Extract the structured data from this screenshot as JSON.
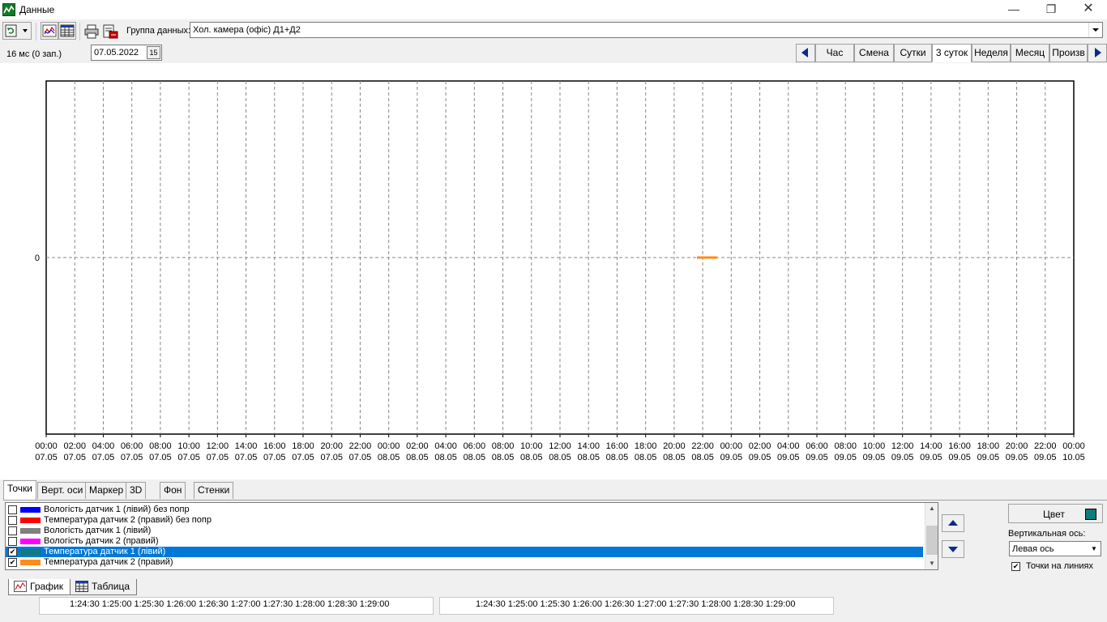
{
  "window": {
    "title": "Данные",
    "min_label": "—",
    "max_label": "❐",
    "close_label": "✕"
  },
  "toolbar": {
    "datagroup_label": "Группа данных:",
    "datagroup_value": "Хол. камера (офіс) Д1+Д2"
  },
  "periodbar": {
    "status": "16 мс (0 зап.)",
    "date": "07.05.2022",
    "calendar_label": "15",
    "buttons": [
      "Час",
      "Смена",
      "Сутки",
      "3 суток",
      "Неделя",
      "Месяц",
      "Произв"
    ],
    "active": "3 суток"
  },
  "chart_data": {
    "type": "line",
    "y_tick_labels": [
      "0"
    ],
    "x_tick_labels": [
      [
        "00:00",
        "07.05"
      ],
      [
        "02:00",
        "07.05"
      ],
      [
        "04:00",
        "07.05"
      ],
      [
        "06:00",
        "07.05"
      ],
      [
        "08:00",
        "07.05"
      ],
      [
        "10:00",
        "07.05"
      ],
      [
        "12:00",
        "07.05"
      ],
      [
        "14:00",
        "07.05"
      ],
      [
        "16:00",
        "07.05"
      ],
      [
        "18:00",
        "07.05"
      ],
      [
        "20:00",
        "07.05"
      ],
      [
        "22:00",
        "07.05"
      ],
      [
        "00:00",
        "08.05"
      ],
      [
        "02:00",
        "08.05"
      ],
      [
        "04:00",
        "08.05"
      ],
      [
        "06:00",
        "08.05"
      ],
      [
        "08:00",
        "08.05"
      ],
      [
        "10:00",
        "08.05"
      ],
      [
        "12:00",
        "08.05"
      ],
      [
        "14:00",
        "08.05"
      ],
      [
        "16:00",
        "08.05"
      ],
      [
        "18:00",
        "08.05"
      ],
      [
        "20:00",
        "08.05"
      ],
      [
        "22:00",
        "08.05"
      ],
      [
        "00:00",
        "09.05"
      ],
      [
        "02:00",
        "09.05"
      ],
      [
        "04:00",
        "09.05"
      ],
      [
        "06:00",
        "09.05"
      ],
      [
        "08:00",
        "09.05"
      ],
      [
        "10:00",
        "09.05"
      ],
      [
        "12:00",
        "09.05"
      ],
      [
        "14:00",
        "09.05"
      ],
      [
        "16:00",
        "09.05"
      ],
      [
        "18:00",
        "09.05"
      ],
      [
        "20:00",
        "09.05"
      ],
      [
        "22:00",
        "09.05"
      ],
      [
        "00:00",
        "10.05"
      ]
    ],
    "x_range_hours": [
      0,
      72
    ],
    "grid": "dashed",
    "series": [
      {
        "name": "Температура датчик 1 (лівий)",
        "color": "#127a79",
        "x_hours": [
          45.6,
          47.0
        ],
        "y": [
          0,
          0
        ]
      },
      {
        "name": "Температура датчик 2 (правий)",
        "color": "#ff8c1a",
        "x_hours": [
          45.6,
          47.0
        ],
        "y": [
          0,
          0
        ]
      }
    ]
  },
  "options": {
    "tabs": [
      "Точки",
      "Верт. оси",
      "Маркер",
      "3D",
      "Фон",
      "Стенки"
    ],
    "active_tab": "Точки",
    "series_list": [
      {
        "label": "Вологість датчик 1 (лівий) без попр",
        "color": "#0000ff",
        "checked": false,
        "selected": false
      },
      {
        "label": "Температура датчик 2 (правий) без попр",
        "color": "#ff0000",
        "checked": false,
        "selected": false
      },
      {
        "label": "Вологість датчик 1 (лівий)",
        "color": "#808080",
        "checked": false,
        "selected": false
      },
      {
        "label": "Вологість датчик 2 (правий)",
        "color": "#ff00ff",
        "checked": false,
        "selected": false
      },
      {
        "label": "Температура датчик 1 (лівий)",
        "color": "#127a79",
        "checked": true,
        "selected": true
      },
      {
        "label": "Температура датчик 2 (правий)",
        "color": "#ff8c1a",
        "checked": true,
        "selected": false
      }
    ],
    "color_label": "Цвет",
    "axis_label": "Вертикальная ось:",
    "axis_value": "Левая ось",
    "points_label": "Точки на линиях",
    "points_checked": true
  },
  "view_tabs": {
    "graph": "График",
    "table": "Таблица"
  },
  "strips": {
    "left": "1:24:30  1:25:00  1:25:30  1:26:00  1:26:30  1:27:00  1:27:30  1:28:00  1:28:30  1:29:00",
    "right": "1:24:30  1:25:00  1:25:30  1:26:00  1:26:30  1:27:00  1:27:30  1:28:00  1:28:30  1:29:00"
  }
}
